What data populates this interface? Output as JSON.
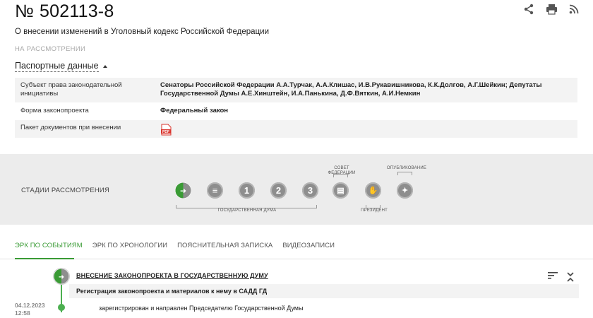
{
  "bill": {
    "number_prefix": "№",
    "number": "502113-8",
    "title": "О внесении изменений в Уголовный кодекс Российской Федерации",
    "status": "НА РАССМОТРЕНИИ"
  },
  "header_icons": [
    "share-icon",
    "print-icon",
    "rss-icon"
  ],
  "passport": {
    "toggle_label": "Паспортные данные",
    "rows": [
      {
        "key": "Субъект права законодательной инициативы",
        "value": "Сенаторы Российской Федерации А.А.Турчак, А.А.Клишас, И.В.Рукавишникова, К.К.Долгов, А.Г.Шейкин; Депутаты Государственной Думы А.Е.Хинштейн, И.А.Панькина, Д.Ф.Вяткин, А.И.Немкин"
      },
      {
        "key": "Форма законопроекта",
        "value": "Федеральный закон"
      },
      {
        "key": "Пакет документов при внесении",
        "value": ""
      }
    ],
    "pdf_label": "PDF"
  },
  "stages": {
    "label": "СТАДИИ РАССМОТРЕНИЯ",
    "items": [
      {
        "name": "introduction",
        "glyph": "➜",
        "active": true
      },
      {
        "name": "preliminary",
        "glyph": "≡"
      },
      {
        "name": "reading-1",
        "glyph": "1"
      },
      {
        "name": "reading-2",
        "glyph": "2"
      },
      {
        "name": "reading-3",
        "glyph": "3"
      },
      {
        "name": "federation-council",
        "glyph": "▤"
      },
      {
        "name": "president",
        "glyph": "✋"
      },
      {
        "name": "publication",
        "glyph": "✦"
      }
    ],
    "duma_label": "ГОСУДАРСТВЕННАЯ ДУМА",
    "council_label_1": "СОВЕТ",
    "council_label_2": "ФЕДЕРАЦИИ",
    "president_label": "ПРЕЗИДЕНТ",
    "publication_label": "ОПУБЛИКОВАНИЕ"
  },
  "tabs": [
    "ЭРК ПО СОБЫТИЯМ",
    "ЭРК ПО ХРОНОЛОГИИ",
    "ПОЯСНИТЕЛЬНАЯ ЗАПИСКА",
    "ВИДЕОЗАПИСИ"
  ],
  "active_tab_index": 0,
  "event": {
    "title": "ВНЕСЕНИЕ ЗАКОНОПРОЕКТА В ГОСУДАРСТВЕННУЮ ДУМУ",
    "subtitle": "Регистрация законопроекта и материалов к нему в САДД ГД",
    "date": "04.12.2023",
    "time": "12:58",
    "text": "зарегистрирован и направлен Председателю Государственной Думы"
  },
  "colors": {
    "accent": "#3a9b35",
    "stage_gray": "#8e8e8e",
    "band": "#ececec",
    "pdf_red": "#d9332b"
  }
}
